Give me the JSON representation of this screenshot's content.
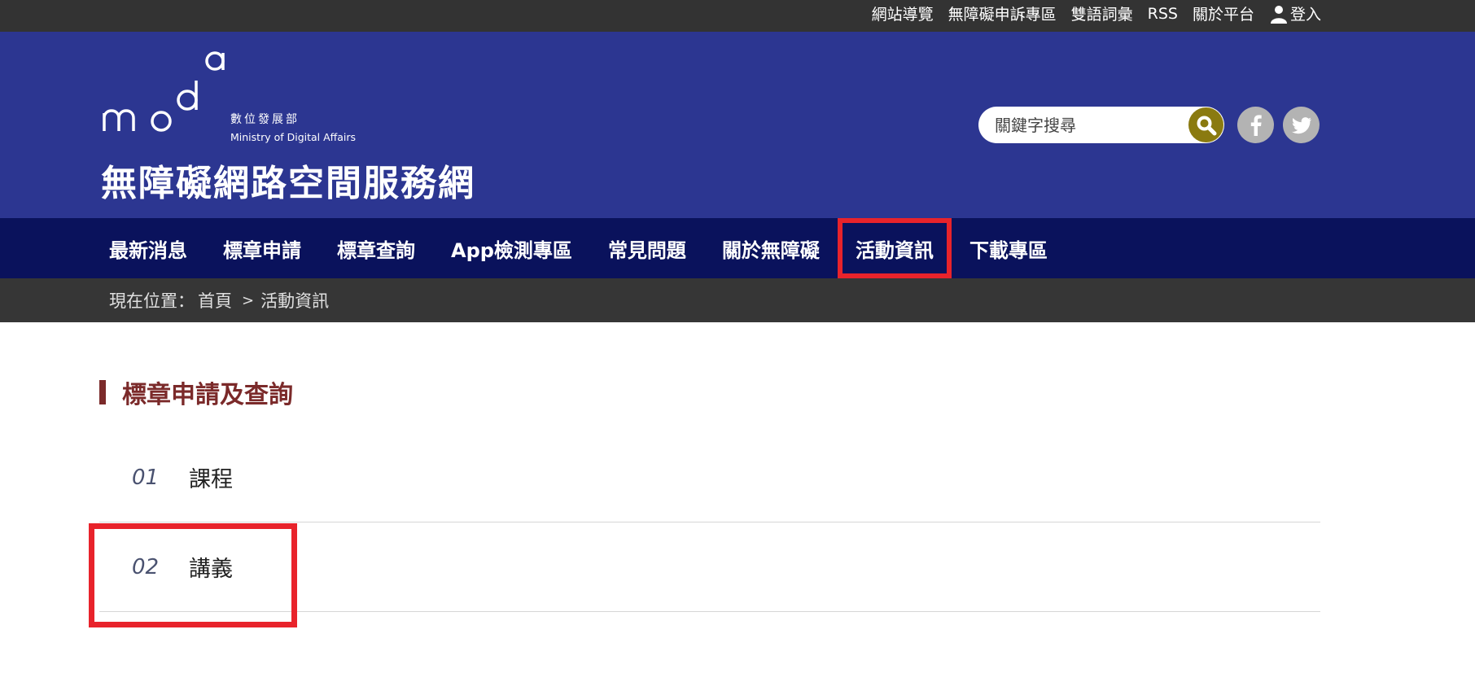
{
  "topbar": {
    "links": [
      "網站導覽",
      "無障礙申訴專區",
      "雙語詞彙",
      "RSS",
      "關於平台"
    ],
    "login_label": "登入"
  },
  "header": {
    "logo_mark": "moda",
    "logo_cn": "數位發展部",
    "logo_en": "Ministry of Digital Affairs",
    "site_title": "無障礙網路空間服務網",
    "search_placeholder": "關鍵字搜尋"
  },
  "nav": {
    "items": [
      "最新消息",
      "標章申請",
      "標章查詢",
      "App檢測專區",
      "常見問題",
      "關於無障礙",
      "活動資訊",
      "下載專區"
    ],
    "active_index": 6
  },
  "breadcrumb": {
    "prefix": "現在位置：",
    "home": "首頁",
    "separator": ">",
    "current": "活動資訊"
  },
  "content": {
    "section_title": "標章申請及查詢",
    "items": [
      {
        "num": "01",
        "label": "課程"
      },
      {
        "num": "02",
        "label": "講義"
      }
    ]
  },
  "colors": {
    "header_bg": "#2c3691",
    "nav_bg": "#0a125c",
    "topbar_bg": "#333333",
    "highlight": "#e8232b",
    "section_title": "#7b2a2a"
  }
}
